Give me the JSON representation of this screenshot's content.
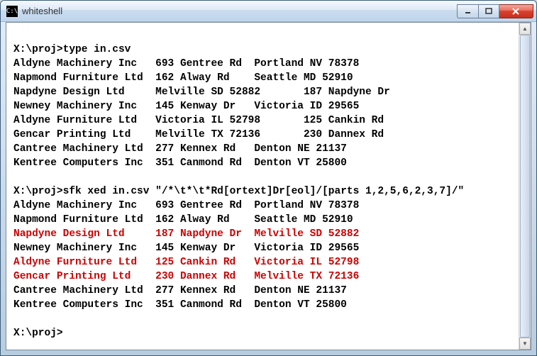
{
  "window": {
    "title": "whiteshell",
    "icon_glyph": "C:\\"
  },
  "prompt1": "X:\\proj>",
  "cmd1": "type in.csv",
  "rows1": [
    {
      "c1": "Aldyne Machinery Inc   ",
      "c2": "693 Gentree Rd  ",
      "c3": "Portland NV 78378"
    },
    {
      "c1": "Napmond Furniture Ltd  ",
      "c2": "162 Alway Rd    ",
      "c3": "Seattle MD 52910"
    },
    {
      "c1": "Napdyne Design Ltd     ",
      "c2": "Melville SD 52882       ",
      "c3": "187 Napdyne Dr"
    },
    {
      "c1": "Newney Machinery Inc   ",
      "c2": "145 Kenway Dr   ",
      "c3": "Victoria ID 29565"
    },
    {
      "c1": "Aldyne Furniture Ltd   ",
      "c2": "Victoria IL 52798       ",
      "c3": "125 Cankin Rd"
    },
    {
      "c1": "Gencar Printing Ltd    ",
      "c2": "Melville TX 72136       ",
      "c3": "230 Dannex Rd"
    },
    {
      "c1": "Cantree Machinery Ltd  ",
      "c2": "277 Kennex Rd   ",
      "c3": "Denton NE 21137"
    },
    {
      "c1": "Kentree Computers Inc  ",
      "c2": "351 Canmond Rd  ",
      "c3": "Denton VT 25800"
    }
  ],
  "prompt2": "X:\\proj>",
  "cmd2": "sfk xed in.csv \"/*\\t*\\t*Rd[ortext]Dr[eol]/[parts 1,2,5,6,2,3,7]/\"",
  "rows2": [
    {
      "c1": "Aldyne Machinery Inc   ",
      "c2": "693 Gentree Rd  ",
      "c3": "Portland NV 78378",
      "hl": false
    },
    {
      "c1": "Napmond Furniture Ltd  ",
      "c2": "162 Alway Rd    ",
      "c3": "Seattle MD 52910",
      "hl": false
    },
    {
      "c1": "Napdyne Design Ltd     ",
      "c2": "187 Napdyne Dr  ",
      "c3": "Melville SD 52882",
      "hl": true
    },
    {
      "c1": "Newney Machinery Inc   ",
      "c2": "145 Kenway Dr   ",
      "c3": "Victoria ID 29565",
      "hl": false
    },
    {
      "c1": "Aldyne Furniture Ltd   ",
      "c2": "125 Cankin Rd   ",
      "c3": "Victoria IL 52798",
      "hl": true
    },
    {
      "c1": "Gencar Printing Ltd    ",
      "c2": "230 Dannex Rd   ",
      "c3": "Melville TX 72136",
      "hl": true
    },
    {
      "c1": "Cantree Machinery Ltd  ",
      "c2": "277 Kennex Rd   ",
      "c3": "Denton NE 21137",
      "hl": false
    },
    {
      "c1": "Kentree Computers Inc  ",
      "c2": "351 Canmond Rd  ",
      "c3": "Denton VT 25800",
      "hl": false
    }
  ],
  "prompt3": "X:\\proj>"
}
